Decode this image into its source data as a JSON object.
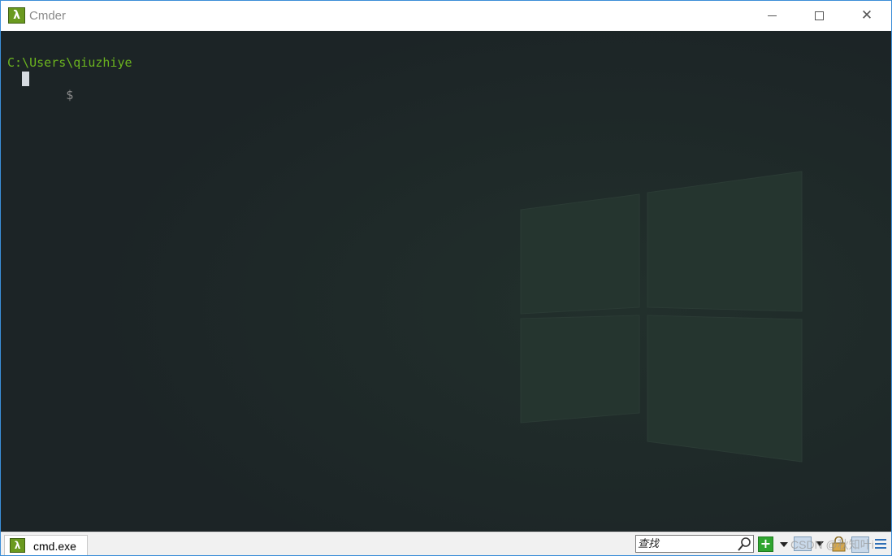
{
  "window": {
    "title": "Cmder",
    "app_icon_glyph": "λ",
    "close_glyph": "✕"
  },
  "console": {
    "path": "C:\\Users\\qiuzhiye",
    "prompt": "$"
  },
  "statusbar": {
    "tab_label": "cmd.exe",
    "tab_icon_glyph": "λ",
    "search_placeholder": "查找",
    "add_glyph": "+",
    "watermark": "CSDN @秋知叶i"
  },
  "colors": {
    "console_bg": "#1d2628",
    "path_text": "#6cb51f",
    "prompt_text": "#8b8b8b",
    "icon_green": "#6a9a1f",
    "window_border": "#3b8ed8"
  },
  "icons": [
    "lambda-icon",
    "minimize-icon",
    "maximize-icon",
    "close-icon",
    "search-icon",
    "plus-icon",
    "chevron-down-icon",
    "console-icon",
    "lock-icon",
    "split-icon",
    "hamburger-menu-icon"
  ]
}
